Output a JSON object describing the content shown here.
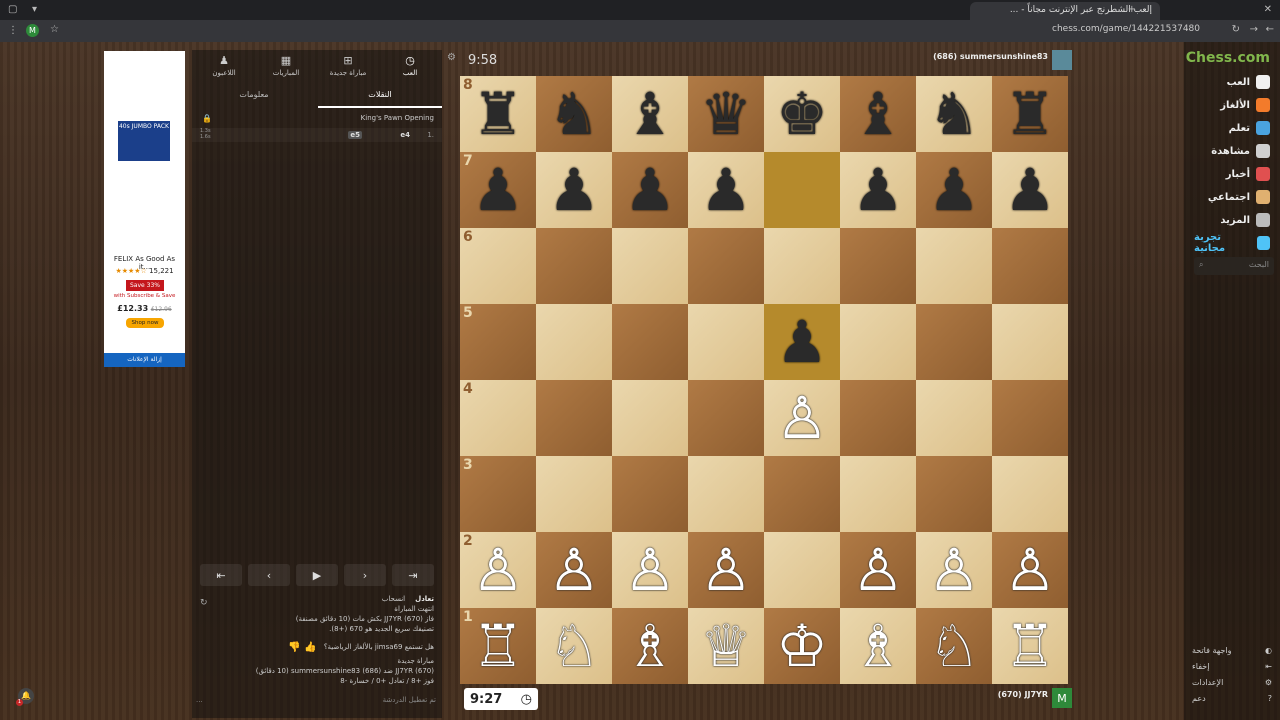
{
  "browser": {
    "tab_title": "إلعب الشطرنج عبر الإنترنت مجاناً - ...",
    "url": "chess.com/game/144221537480"
  },
  "nav": {
    "logo_prefix": "Chess",
    "logo_suffix": ".com",
    "items": [
      {
        "label": "العب",
        "icon": "play-pawn-icon",
        "color": "#f0f0f0"
      },
      {
        "label": "الألغاز",
        "icon": "puzzle-icon",
        "color": "#f37b2b"
      },
      {
        "label": "تعلم",
        "icon": "learn-cap-icon",
        "color": "#4aa3df"
      },
      {
        "label": "مشاهدة",
        "icon": "watch-binoculars-icon",
        "color": "#d0d0d0"
      },
      {
        "label": "أخبار",
        "icon": "news-icon",
        "color": "#e05050"
      },
      {
        "label": "اجتماعي",
        "icon": "social-icon",
        "color": "#e0b070"
      },
      {
        "label": "المزيد",
        "icon": "more-dots-icon",
        "color": "#bbbbbb"
      },
      {
        "label": "تجربة مجانية",
        "icon": "diamond-icon",
        "color": "#4fc3f7"
      }
    ],
    "search_placeholder": "البحث",
    "bottom": [
      {
        "label": "واجهة فاتحة",
        "icon": "theme-icon"
      },
      {
        "label": "إخفاء",
        "icon": "collapse-icon"
      },
      {
        "label": "الإعدادات",
        "icon": "gear-icon"
      },
      {
        "label": "دعم",
        "icon": "help-icon"
      }
    ]
  },
  "game": {
    "opponent": {
      "name": "summersunshine83",
      "rating": "(686)"
    },
    "me": {
      "name": "JJ7YR",
      "rating": "(670)",
      "avatar_letter": "M"
    },
    "top_clock": "9:58",
    "bottom_clock": "9:27",
    "board": [
      [
        "♜",
        "♞",
        "♝",
        "♛",
        "♚",
        "♝",
        "♞",
        "♜"
      ],
      [
        "♟",
        "♟",
        "♟",
        "♟",
        "",
        "♟",
        "♟",
        "♟"
      ],
      [
        "",
        "",
        "",
        "",
        "",
        "",
        "",
        ""
      ],
      [
        "",
        "",
        "",
        "",
        "♟",
        "",
        "",
        ""
      ],
      [
        "",
        "",
        "",
        "",
        "♙",
        "",
        "",
        ""
      ],
      [
        "",
        "",
        "",
        "",
        "",
        "",
        "",
        ""
      ],
      [
        "♙",
        "♙",
        "♙",
        "♙",
        "",
        "♙",
        "♙",
        "♙"
      ],
      [
        "♖",
        "♘",
        "♗",
        "♕",
        "♔",
        "♗",
        "♘",
        "♖"
      ]
    ],
    "ranks": [
      "8",
      "7",
      "6",
      "5",
      "4",
      "3",
      "2",
      "1"
    ],
    "highlight_squares": [
      "e7",
      "e5"
    ]
  },
  "panel": {
    "tabs": [
      "العب",
      "مباراة جديدة",
      "المباريات",
      "اللاعبون"
    ],
    "subtabs": [
      "النقلات",
      "معلومات"
    ],
    "opening": "King's Pawn Opening",
    "move_number": "1.",
    "white_move": "e4",
    "black_move": "e5",
    "move_times": [
      "1.3s",
      "1.6s"
    ],
    "controls": [
      "⇤",
      "‹",
      "▶",
      "›",
      "⇥"
    ],
    "draw_label": "تعادل",
    "resign_label": "انسحاب",
    "result_title": "انتهت المباراة",
    "result_line1": "فاز JJ7YR (670) بكش مات (10 دقائق مصنفة)",
    "result_line2": "تصنيفك سريع الجديد هو 670 (+8).",
    "question": "هل تستمع jimsa69 بالألغاز الرياضية؟",
    "new_game_title": "مباراة جديدة",
    "new_game_line": "JJ7YR (670) ضد summersunshine83 (686) (10 دقائق)",
    "new_game_stats": "فوز +8 / تعادل +0 / خسارة -8",
    "chat_disabled": "تم تعطيل الدردشة",
    "more": "..."
  },
  "ad": {
    "img_label": "40s JUMBO PACK",
    "title": "FELIX As Good As it...",
    "stars": "★★★★☆",
    "reviews": "15,221",
    "save": "Save 33%",
    "subscribe": "with Subscribe & Save",
    "price": "£12.33",
    "old_price": "£12.96",
    "shop": "Shop now",
    "remove": "إزالة الإعلانات"
  },
  "notif": {
    "count": "1"
  }
}
